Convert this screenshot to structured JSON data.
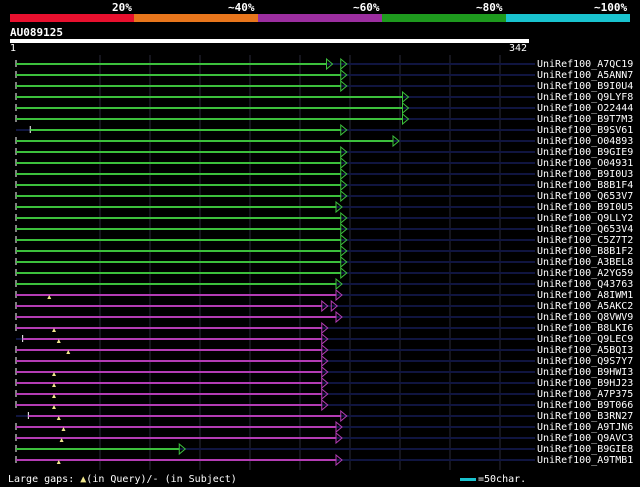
{
  "scale": {
    "labels": [
      "20%",
      "~40%",
      "~60%",
      "~80%",
      "~100%"
    ],
    "colors": [
      "#e8102e",
      "#e8761c",
      "#9c2ea0",
      "#1e9a1e",
      "#19c3cf"
    ]
  },
  "query": {
    "id": "AU089125",
    "start": "1",
    "end": "342"
  },
  "hits": [
    {
      "name": "UniRef100_A7QC19",
      "start": 1,
      "end": 330,
      "color": "#3cc03c",
      "dashed_end": 345
    },
    {
      "name": "UniRef100_A5ANN7",
      "start": 1,
      "end": 345,
      "color": "#3cc03c"
    },
    {
      "name": "UniRef100_B9I0U4",
      "start": 1,
      "end": 345,
      "color": "#3cc03c"
    },
    {
      "name": "UniRef100_Q9LYF8",
      "start": 1,
      "end": 410,
      "color": "#3cc03c"
    },
    {
      "name": "UniRef100_O22444",
      "start": 1,
      "end": 410,
      "color": "#3cc03c"
    },
    {
      "name": "UniRef100_B9T7M3",
      "start": 1,
      "end": 410,
      "color": "#3cc03c"
    },
    {
      "name": "UniRef100_B9SV61",
      "start": 16,
      "end": 345,
      "color": "#3cc03c"
    },
    {
      "name": "UniRef100_O04893",
      "start": 1,
      "end": 400,
      "color": "#3cc03c"
    },
    {
      "name": "UniRef100_B9GIE9",
      "start": 1,
      "end": 345,
      "color": "#3cc03c"
    },
    {
      "name": "UniRef100_O04931",
      "start": 1,
      "end": 345,
      "color": "#3cc03c"
    },
    {
      "name": "UniRef100_B9I0U3",
      "start": 1,
      "end": 345,
      "color": "#3cc03c"
    },
    {
      "name": "UniRef100_B8B1F4",
      "start": 1,
      "end": 345,
      "color": "#3cc03c"
    },
    {
      "name": "UniRef100_Q653V7",
      "start": 1,
      "end": 345,
      "color": "#3cc03c"
    },
    {
      "name": "UniRef100_B9I0U5",
      "start": 1,
      "end": 340,
      "color": "#3cc03c"
    },
    {
      "name": "UniRef100_Q9LLY2",
      "start": 1,
      "end": 345,
      "color": "#3cc03c"
    },
    {
      "name": "UniRef100_Q653V4",
      "start": 1,
      "end": 345,
      "color": "#3cc03c"
    },
    {
      "name": "UniRef100_C5Z7T2",
      "start": 1,
      "end": 345,
      "color": "#3cc03c"
    },
    {
      "name": "UniRef100_B8B1F2",
      "start": 1,
      "end": 345,
      "color": "#3cc03c"
    },
    {
      "name": "UniRef100_A3BEL8",
      "start": 1,
      "end": 345,
      "color": "#3cc03c"
    },
    {
      "name": "UniRef100_A2YG59",
      "start": 1,
      "end": 345,
      "color": "#3cc03c"
    },
    {
      "name": "UniRef100_Q43763",
      "start": 1,
      "end": 340,
      "color": "#3cc03c"
    },
    {
      "name": "UniRef100_A8IWM1",
      "start": 1,
      "end": 340,
      "color": "#b43cb4",
      "gap": 35
    },
    {
      "name": "UniRef100_A5AKC2",
      "start": 1,
      "end": 325,
      "color": "#b43cb4",
      "dashed_end": 335
    },
    {
      "name": "UniRef100_Q8VWV9",
      "start": 1,
      "end": 340,
      "color": "#b43cb4"
    },
    {
      "name": "UniRef100_B8LKI6",
      "start": 1,
      "end": 325,
      "color": "#b43cb4",
      "gap": 40
    },
    {
      "name": "UniRef100_Q9LEC9",
      "start": 8,
      "end": 325,
      "color": "#b43cb4",
      "gap": 45
    },
    {
      "name": "UniRef100_A5BQI3",
      "start": 1,
      "end": 325,
      "color": "#b43cb4",
      "gap": 55
    },
    {
      "name": "UniRef100_Q9S7Y7",
      "start": 1,
      "end": 325,
      "color": "#b43cb4"
    },
    {
      "name": "UniRef100_B9HWI3",
      "start": 1,
      "end": 325,
      "color": "#b43cb4",
      "gap": 40
    },
    {
      "name": "UniRef100_B9HJ23",
      "start": 1,
      "end": 325,
      "color": "#b43cb4",
      "gap": 40
    },
    {
      "name": "UniRef100_A7P375",
      "start": 1,
      "end": 325,
      "color": "#b43cb4",
      "gap": 40
    },
    {
      "name": "UniRef100_B9T066",
      "start": 1,
      "end": 325,
      "color": "#b43cb4",
      "gap": 40
    },
    {
      "name": "UniRef100_B3RN27",
      "start": 14,
      "end": 345,
      "color": "#b43cb4",
      "gap": 45
    },
    {
      "name": "UniRef100_A9TJN6",
      "start": 1,
      "end": 340,
      "color": "#b43cb4",
      "gap": 50
    },
    {
      "name": "UniRef100_Q9AVC3",
      "start": 1,
      "end": 340,
      "color": "#b43cb4",
      "gap": 48
    },
    {
      "name": "UniRef100_B9GIE8",
      "start": 1,
      "end": 175,
      "color": "#3cc03c"
    },
    {
      "name": "UniRef100_A9TMB1",
      "start": 1,
      "end": 340,
      "color": "#b43cb4",
      "gap": 45
    }
  ],
  "footer": {
    "legend_label": "Large gaps:",
    "in_query": "(in Query)/",
    "in_subject": "- (in Subject)",
    "scale_label": "=50char."
  }
}
